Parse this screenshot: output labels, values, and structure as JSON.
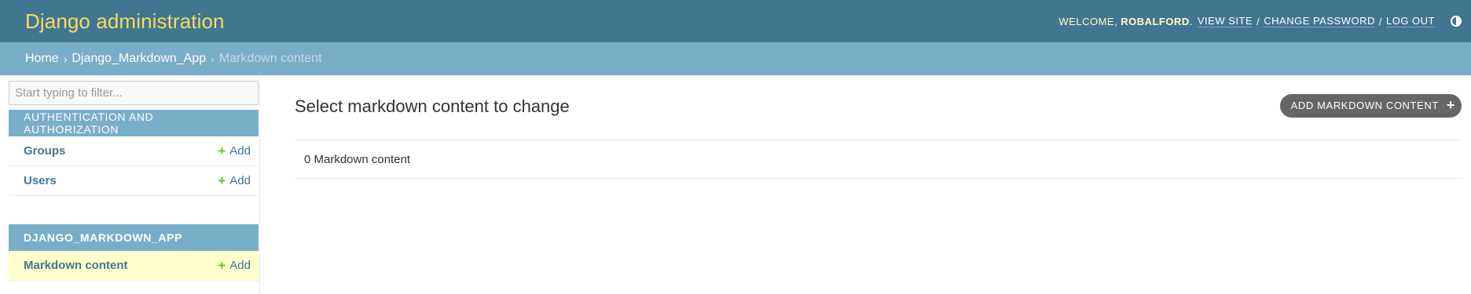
{
  "header": {
    "branding": "Django administration",
    "welcome": "Welcome,",
    "username": "robalford",
    "view_site": "View site",
    "change_password": "Change password",
    "log_out": "Log out",
    "sep": "/"
  },
  "breadcrumbs": {
    "home": "Home",
    "app": "Django_Markdown_App",
    "current": "Markdown content",
    "arrow": "›"
  },
  "sidebar": {
    "filter_placeholder": "Start typing to filter...",
    "modules": [
      {
        "caption": "Authentication and Authorization",
        "rows": [
          {
            "label": "Groups",
            "add": "Add"
          },
          {
            "label": "Users",
            "add": "Add"
          }
        ]
      },
      {
        "caption": "Django_Markdown_App",
        "rows": [
          {
            "label": "Markdown content",
            "add": "Add"
          }
        ]
      }
    ]
  },
  "content": {
    "title": "Select markdown content to change",
    "add_button": "Add markdown content",
    "result_count": "0 Markdown content"
  },
  "icons": {
    "add": "plus-icon",
    "theme": "theme-toggle-icon"
  },
  "colors": {
    "header_bg": "#417690",
    "branding": "#f5dd5d",
    "breadcrumbs_bg": "#79aec8",
    "caption_bg": "#79aec8",
    "current_row_bg": "#ffffcc",
    "add_green": "#70bf2b",
    "button_bg": "#666666"
  }
}
